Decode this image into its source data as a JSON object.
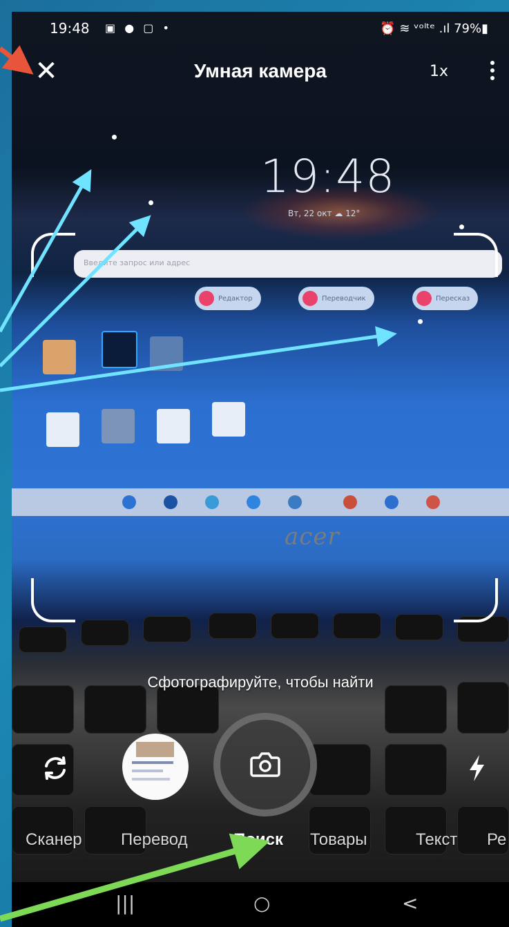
{
  "status_bar": {
    "time": "19:48",
    "icons": "▣ ● ▢ •",
    "right": "⏰ ≋ ᵛᵒˡᵗᵉ .ıl 79%▮"
  },
  "top_bar": {
    "title": "Умная камера",
    "zoom": "1x",
    "close": "✕"
  },
  "scene": {
    "lock_time": "19:48",
    "lock_date": "Вт, 22 окт ☁ 12°",
    "browser_placeholder": "Введите запрос или адрес",
    "chips": [
      "Редактор",
      "Переводчик",
      "Пересказ"
    ],
    "brand": "acer"
  },
  "hint": "Сфотографируйте, чтобы найти",
  "modes": {
    "items": [
      "Сканер",
      "Перевод",
      "Поиск",
      "Товары",
      "Текст",
      "Ре"
    ],
    "active": "Поиск"
  },
  "navbar": {
    "recent": "|||",
    "home": "○",
    "back": "<"
  },
  "colors": {
    "annotation_red": "#e8553a",
    "annotation_cyan": "#6fe3ff",
    "annotation_green": "#7ed957"
  }
}
